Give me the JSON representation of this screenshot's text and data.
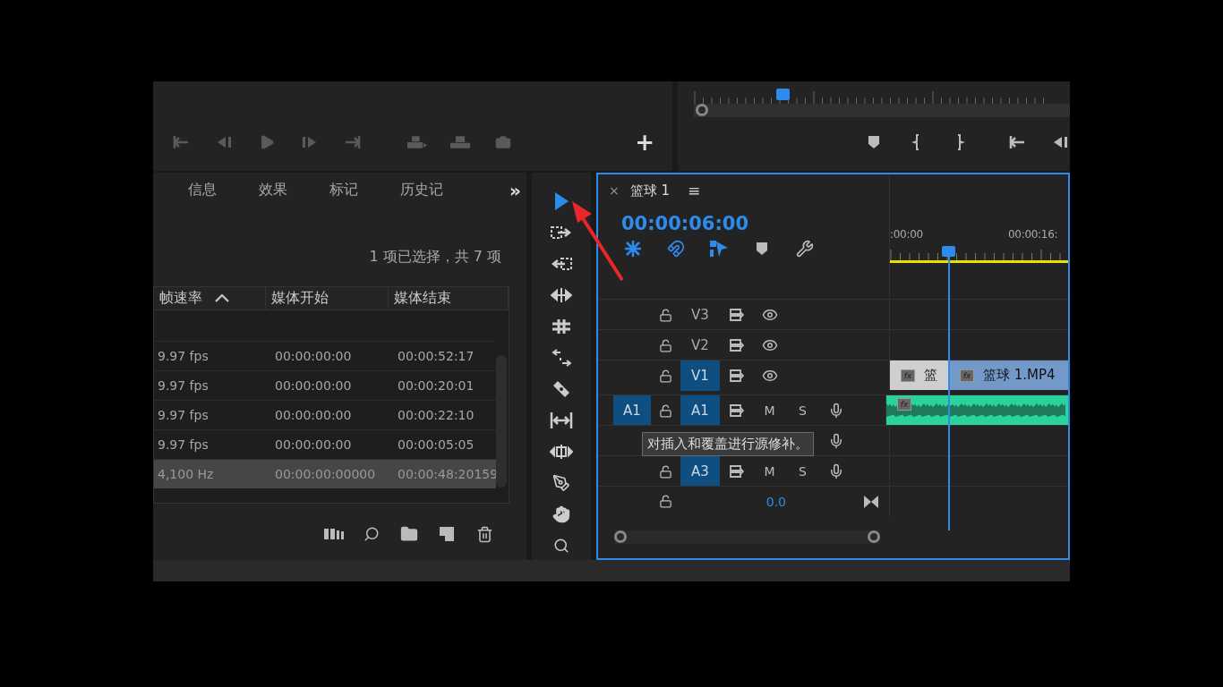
{
  "source_monitor": {
    "transport": [
      {
        "kind": "mark-in"
      },
      {
        "kind": "step-back"
      },
      {
        "kind": "play"
      },
      {
        "kind": "step-forward"
      },
      {
        "kind": "mark-out"
      },
      {
        "kind": "insert"
      },
      {
        "kind": "overwrite"
      },
      {
        "kind": "export-frame"
      }
    ],
    "add_button": "+"
  },
  "program_monitor": {
    "buttons": [
      {
        "kind": "marker"
      },
      {
        "kind": "mark-in"
      },
      {
        "kind": "mark-out"
      },
      {
        "kind": "go-in"
      },
      {
        "kind": "step-back"
      }
    ]
  },
  "project_panel": {
    "tabs": [
      {
        "label": "信息",
        "selected": false
      },
      {
        "label": "效果",
        "selected": false
      },
      {
        "label": "标记",
        "selected": false
      },
      {
        "label": "历史记",
        "selected": false
      }
    ],
    "overflow": "»",
    "selection_status": "1 项已选择，共 7 项",
    "columns": [
      "帧速率",
      "媒体开始",
      "媒体结束"
    ],
    "rows": [
      {
        "cells": [
          "9.97 fps",
          "00:00:00:00",
          "00:00:52:17"
        ],
        "selected": false
      },
      {
        "cells": [
          "9.97 fps",
          "00:00:00:00",
          "00:00:20:01"
        ],
        "selected": false
      },
      {
        "cells": [
          "9.97 fps",
          "00:00:00:00",
          "00:00:22:10"
        ],
        "selected": false
      },
      {
        "cells": [
          "9.97 fps",
          "00:00:00:00",
          "00:00:05:05"
        ],
        "selected": false
      },
      {
        "cells": [
          "4,100 Hz",
          "00:00:00:00000",
          "00:00:48:20159"
        ],
        "selected": true
      }
    ]
  },
  "tools": [
    {
      "selected": true
    },
    {
      "selected": false
    },
    {
      "selected": false
    },
    {
      "selected": false
    },
    {
      "selected": false
    },
    {
      "selected": false
    },
    {
      "selected": false
    },
    {
      "selected": false
    },
    {
      "selected": false
    },
    {
      "selected": false
    },
    {
      "selected": false
    },
    {
      "selected": false
    }
  ],
  "timeline": {
    "close": "×",
    "title": "篮球 1",
    "menu": "≡",
    "timecode": "00:00:06:00",
    "toggles": [
      {
        "on": true
      },
      {
        "on": true
      },
      {
        "on": true
      }
    ],
    "ruler_labels": [
      ":00:00",
      "00:00:16:"
    ],
    "tracks": [
      {
        "kind": "video",
        "label": "V3",
        "targeted": false
      },
      {
        "kind": "video",
        "label": "V2",
        "targeted": false
      },
      {
        "kind": "video",
        "label": "V1",
        "targeted": true
      },
      {
        "kind": "audio",
        "source": "A1",
        "label": "A1",
        "targeted": true,
        "mute": "M",
        "solo": "S"
      },
      {
        "kind": "audio-hidden"
      },
      {
        "kind": "audio",
        "label": "A3",
        "targeted": true,
        "mute": "M",
        "solo": "S"
      },
      {
        "kind": "master",
        "value": "0.0"
      }
    ],
    "video_clips": [
      {
        "fx": "fx",
        "label": "篮",
        "selected": false
      },
      {
        "fx": "fx",
        "label": "篮球 1.MP4",
        "selected": true
      }
    ],
    "audio_clip": {
      "fx": "fx"
    },
    "tooltip": "对插入和覆盖进行源修补。"
  }
}
